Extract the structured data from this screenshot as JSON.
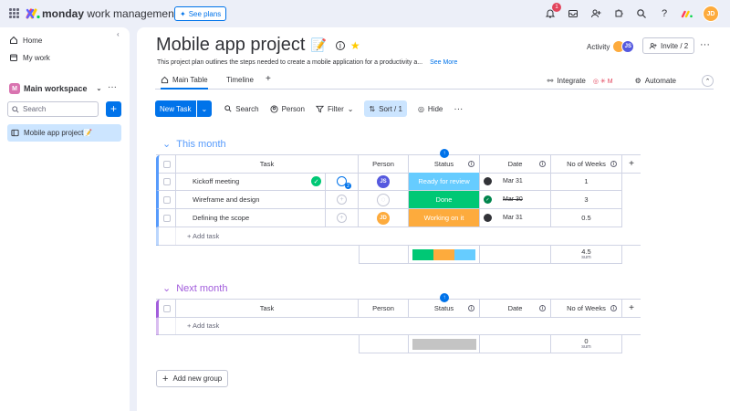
{
  "topbar": {
    "brand_bold": "monday",
    "brand_rest": "work management",
    "see_plans": "See plans",
    "notification_count": "1",
    "user_initials": "JD"
  },
  "sidebar": {
    "home": "Home",
    "my_work": "My work",
    "workspace_initial": "M",
    "workspace": "Main workspace",
    "search_placeholder": "Search",
    "board": "Mobile app project📝"
  },
  "board": {
    "title": "Mobile app project",
    "description": "This project plan outlines the steps needed to create a mobile application for a productivity a...",
    "see_more": "See More",
    "activity": "Activity",
    "invite": "Invite / 2",
    "avatar_initials": "JS"
  },
  "tabs": {
    "main_table": "Main Table",
    "timeline": "Timeline",
    "add": "+",
    "integrate": "Integrate",
    "automate": "Automate"
  },
  "toolbar": {
    "new_task": "New Task",
    "search": "Search",
    "person": "Person",
    "filter": "Filter",
    "sort": "Sort / 1",
    "hide": "Hide"
  },
  "columns": {
    "task": "Task",
    "person": "Person",
    "status": "Status",
    "date": "Date",
    "weeks": "No of Weeks",
    "add": "+"
  },
  "groups": [
    {
      "title": "This month",
      "color": "#579bfc",
      "rows": [
        {
          "task": "Kickoff meeting",
          "person": "JS",
          "person_color": "#5559df",
          "status": "Ready for review",
          "status_color": "#66ccff",
          "date": "Mar 31",
          "weeks": "1"
        },
        {
          "task": "Wireframe and design",
          "person": "",
          "person_color": "",
          "status": "Done",
          "status_color": "#00c875",
          "date": "Mar 30",
          "weeks": "3"
        },
        {
          "task": "Defining the scope",
          "person": "JD",
          "person_color": "#fdab3d",
          "status": "Working on it",
          "status_color": "#fdab3d",
          "date": "Mar 31",
          "weeks": "0.5"
        }
      ],
      "add_task": "+ Add task",
      "sum_value": "4.5",
      "sum_label": "sum"
    },
    {
      "title": "Next month",
      "color": "#a25ddc",
      "rows": [],
      "add_task": "+ Add task",
      "sum_value": "0",
      "sum_label": "sum"
    }
  ],
  "add_group": "Add new group"
}
